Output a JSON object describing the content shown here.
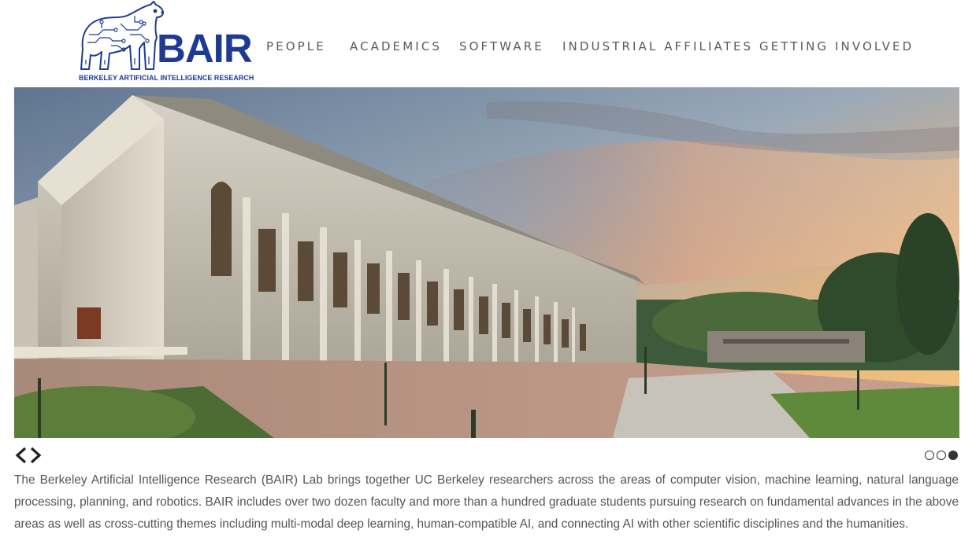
{
  "header": {
    "logo": {
      "word": "BAIR",
      "subtitle": "BERKELEY ARTIFICIAL INTELLIGENCE RESEARCH",
      "icon": "bear-circuit-logo",
      "brand_color": "#1f3a93"
    },
    "nav": [
      {
        "label": "PEOPLE"
      },
      {
        "label": "ACADEMICS"
      },
      {
        "label": "SOFTWARE"
      },
      {
        "label": "INDUSTRIAL AFFILIATES"
      },
      {
        "label": "GETTING INVOLVED"
      }
    ]
  },
  "carousel": {
    "image": "campus-library-sunset",
    "prev_icon": "chevron-left-icon",
    "next_icon": "chevron-right-icon",
    "slide_count": 3,
    "active_slide": 3
  },
  "description": "The Berkeley Artificial Intelligence Research (BAIR) Lab brings together UC Berkeley researchers across the areas of computer vision, machine learning, natural language processing, planning, and robotics. BAIR includes over two dozen faculty and more than a hundred graduate students pursuing research on fundamental advances in the above areas as well as cross-cutting themes including multi-modal deep learning, human-compatible AI, and connecting AI with other scientific disciplines and the humanities."
}
